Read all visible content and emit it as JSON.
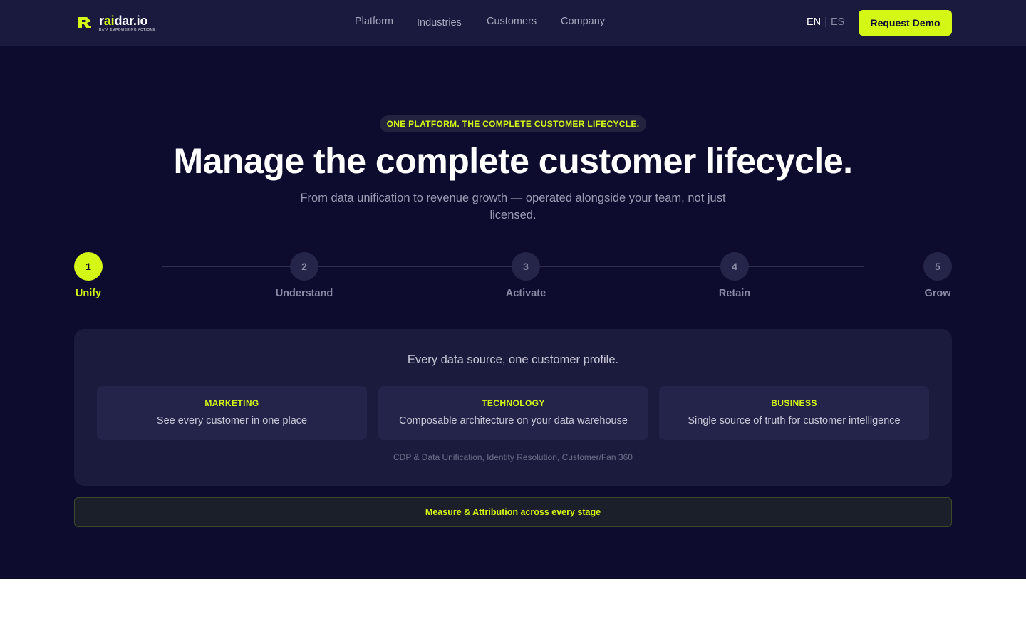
{
  "brand": {
    "name_prefix": "r",
    "name_accent": "ai",
    "name_suffix": "dar.io",
    "tagline": "DATA EMPOWERING ACTIONS",
    "accent_color": "#d4f716",
    "bg_color": "#0d0c2f",
    "logo_icon": "raidar-logo-mark"
  },
  "nav": {
    "items": [
      {
        "label": "Platform"
      },
      {
        "label": "Industries"
      },
      {
        "label": "Customers"
      },
      {
        "label": "Company"
      }
    ]
  },
  "lang": {
    "current": "EN",
    "separator": "|",
    "other": "ES"
  },
  "cta": {
    "label": "Request Demo"
  },
  "hero": {
    "eyebrow": "ONE PLATFORM. THE COMPLETE CUSTOMER LIFECYCLE.",
    "title": "Manage the complete customer lifecycle.",
    "subtitle": "From data unification to revenue growth — operated alongside your team, not just licensed."
  },
  "steps": [
    {
      "number": "1",
      "label": "Unify",
      "active": true
    },
    {
      "number": "2",
      "label": "Understand",
      "active": false
    },
    {
      "number": "3",
      "label": "Activate",
      "active": false
    },
    {
      "number": "4",
      "label": "Retain",
      "active": false
    },
    {
      "number": "5",
      "label": "Grow",
      "active": false
    }
  ],
  "panel": {
    "title": "Every data source, one customer profile.",
    "cards": [
      {
        "category": "MARKETING",
        "description": "See every customer in one place"
      },
      {
        "category": "TECHNOLOGY",
        "description": "Composable architecture on your data warehouse"
      },
      {
        "category": "BUSINESS",
        "description": "Single source of truth for customer intelligence"
      }
    ],
    "footnote": "CDP & Data Unification, Identity Resolution, Customer/Fan 360"
  },
  "measure": {
    "label": "Measure & Attribution across every stage"
  }
}
